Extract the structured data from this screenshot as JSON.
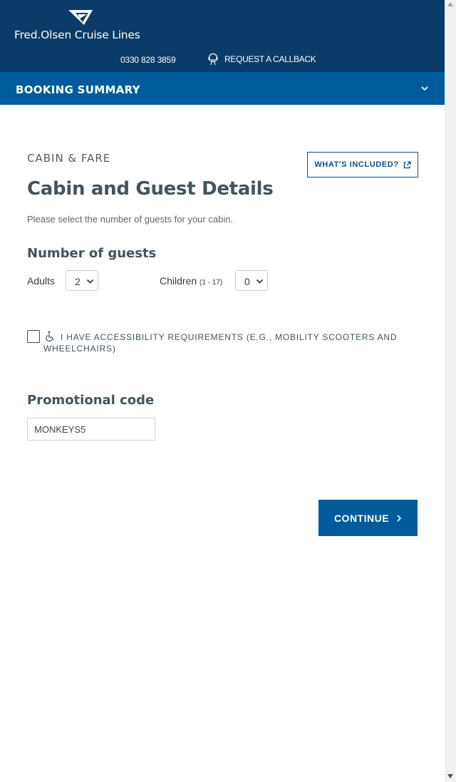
{
  "header": {
    "brand_name": "Fred.Olsen Cruise Lines",
    "phone": "0330 828 3859",
    "callback_label": "REQUEST A CALLBACK",
    "logo_icon": "sail-logo-icon",
    "callback_icon": "headset-icon"
  },
  "summary_bar": {
    "title": "BOOKING SUMMARY",
    "chevron_icon": "chevron-down-icon"
  },
  "main": {
    "section_label": "CABIN & FARE",
    "whats_included_label": "WHAT'S INCLUDED?",
    "title": "Cabin and Guest Details",
    "instruction": "Please select the number of guests for your cabin.",
    "guests_heading": "Number of guests",
    "adults_label": "Adults",
    "adults_value": "2",
    "children_label": "Children",
    "children_range": "(1 - 17)",
    "children_value": "0",
    "accessibility_text": "I HAVE ACCESSIBILITY REQUIREMENTS (E.G., MOBILITY SCOOTERS AND WHEELCHAIRS)",
    "accessibility_checked": false,
    "promo_heading": "Promotional code",
    "promo_value": "MONKEYS5",
    "continue_label": "CONTINUE"
  },
  "colors": {
    "header_bg": "#0b3b68",
    "summary_bg": "#005b9c",
    "accent": "#005b9c",
    "text": "#44535d"
  }
}
